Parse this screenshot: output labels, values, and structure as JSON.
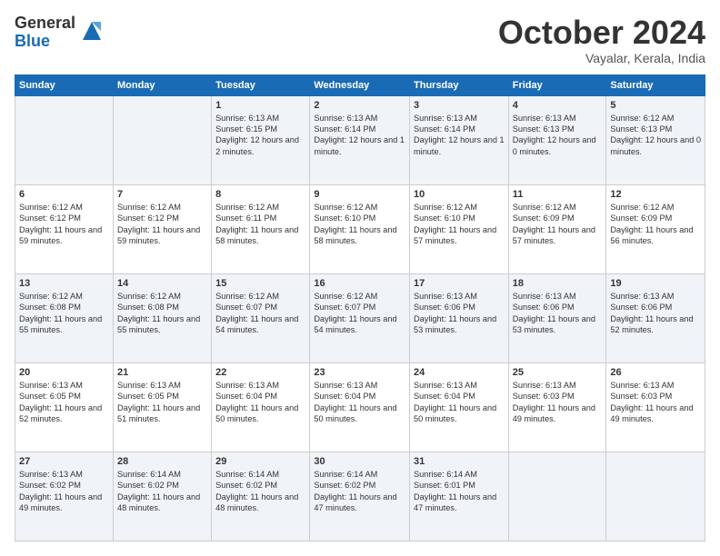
{
  "header": {
    "logo_general": "General",
    "logo_blue": "Blue",
    "month_title": "October 2024",
    "location": "Vayalar, Kerala, India"
  },
  "days_of_week": [
    "Sunday",
    "Monday",
    "Tuesday",
    "Wednesday",
    "Thursday",
    "Friday",
    "Saturday"
  ],
  "weeks": [
    [
      {
        "day": "",
        "info": ""
      },
      {
        "day": "",
        "info": ""
      },
      {
        "day": "1",
        "info": "Sunrise: 6:13 AM\nSunset: 6:15 PM\nDaylight: 12 hours and 2 minutes."
      },
      {
        "day": "2",
        "info": "Sunrise: 6:13 AM\nSunset: 6:14 PM\nDaylight: 12 hours and 1 minute."
      },
      {
        "day": "3",
        "info": "Sunrise: 6:13 AM\nSunset: 6:14 PM\nDaylight: 12 hours and 1 minute."
      },
      {
        "day": "4",
        "info": "Sunrise: 6:13 AM\nSunset: 6:13 PM\nDaylight: 12 hours and 0 minutes."
      },
      {
        "day": "5",
        "info": "Sunrise: 6:12 AM\nSunset: 6:13 PM\nDaylight: 12 hours and 0 minutes."
      }
    ],
    [
      {
        "day": "6",
        "info": "Sunrise: 6:12 AM\nSunset: 6:12 PM\nDaylight: 11 hours and 59 minutes."
      },
      {
        "day": "7",
        "info": "Sunrise: 6:12 AM\nSunset: 6:12 PM\nDaylight: 11 hours and 59 minutes."
      },
      {
        "day": "8",
        "info": "Sunrise: 6:12 AM\nSunset: 6:11 PM\nDaylight: 11 hours and 58 minutes."
      },
      {
        "day": "9",
        "info": "Sunrise: 6:12 AM\nSunset: 6:10 PM\nDaylight: 11 hours and 58 minutes."
      },
      {
        "day": "10",
        "info": "Sunrise: 6:12 AM\nSunset: 6:10 PM\nDaylight: 11 hours and 57 minutes."
      },
      {
        "day": "11",
        "info": "Sunrise: 6:12 AM\nSunset: 6:09 PM\nDaylight: 11 hours and 57 minutes."
      },
      {
        "day": "12",
        "info": "Sunrise: 6:12 AM\nSunset: 6:09 PM\nDaylight: 11 hours and 56 minutes."
      }
    ],
    [
      {
        "day": "13",
        "info": "Sunrise: 6:12 AM\nSunset: 6:08 PM\nDaylight: 11 hours and 55 minutes."
      },
      {
        "day": "14",
        "info": "Sunrise: 6:12 AM\nSunset: 6:08 PM\nDaylight: 11 hours and 55 minutes."
      },
      {
        "day": "15",
        "info": "Sunrise: 6:12 AM\nSunset: 6:07 PM\nDaylight: 11 hours and 54 minutes."
      },
      {
        "day": "16",
        "info": "Sunrise: 6:12 AM\nSunset: 6:07 PM\nDaylight: 11 hours and 54 minutes."
      },
      {
        "day": "17",
        "info": "Sunrise: 6:13 AM\nSunset: 6:06 PM\nDaylight: 11 hours and 53 minutes."
      },
      {
        "day": "18",
        "info": "Sunrise: 6:13 AM\nSunset: 6:06 PM\nDaylight: 11 hours and 53 minutes."
      },
      {
        "day": "19",
        "info": "Sunrise: 6:13 AM\nSunset: 6:06 PM\nDaylight: 11 hours and 52 minutes."
      }
    ],
    [
      {
        "day": "20",
        "info": "Sunrise: 6:13 AM\nSunset: 6:05 PM\nDaylight: 11 hours and 52 minutes."
      },
      {
        "day": "21",
        "info": "Sunrise: 6:13 AM\nSunset: 6:05 PM\nDaylight: 11 hours and 51 minutes."
      },
      {
        "day": "22",
        "info": "Sunrise: 6:13 AM\nSunset: 6:04 PM\nDaylight: 11 hours and 50 minutes."
      },
      {
        "day": "23",
        "info": "Sunrise: 6:13 AM\nSunset: 6:04 PM\nDaylight: 11 hours and 50 minutes."
      },
      {
        "day": "24",
        "info": "Sunrise: 6:13 AM\nSunset: 6:04 PM\nDaylight: 11 hours and 50 minutes."
      },
      {
        "day": "25",
        "info": "Sunrise: 6:13 AM\nSunset: 6:03 PM\nDaylight: 11 hours and 49 minutes."
      },
      {
        "day": "26",
        "info": "Sunrise: 6:13 AM\nSunset: 6:03 PM\nDaylight: 11 hours and 49 minutes."
      }
    ],
    [
      {
        "day": "27",
        "info": "Sunrise: 6:13 AM\nSunset: 6:02 PM\nDaylight: 11 hours and 49 minutes."
      },
      {
        "day": "28",
        "info": "Sunrise: 6:14 AM\nSunset: 6:02 PM\nDaylight: 11 hours and 48 minutes."
      },
      {
        "day": "29",
        "info": "Sunrise: 6:14 AM\nSunset: 6:02 PM\nDaylight: 11 hours and 48 minutes."
      },
      {
        "day": "30",
        "info": "Sunrise: 6:14 AM\nSunset: 6:02 PM\nDaylight: 11 hours and 47 minutes."
      },
      {
        "day": "31",
        "info": "Sunrise: 6:14 AM\nSunset: 6:01 PM\nDaylight: 11 hours and 47 minutes."
      },
      {
        "day": "",
        "info": ""
      },
      {
        "day": "",
        "info": ""
      }
    ]
  ]
}
